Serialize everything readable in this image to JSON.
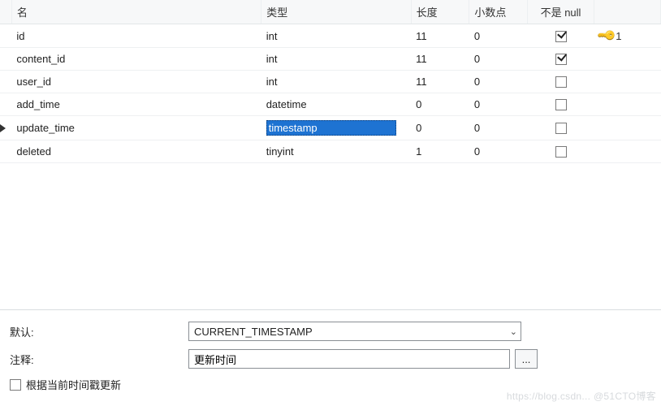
{
  "table": {
    "headers": {
      "name": "名",
      "type": "类型",
      "length": "长度",
      "decimals": "小数点",
      "not_null": "不是 null"
    },
    "rows": [
      {
        "name": "id",
        "type": "int",
        "length": "11",
        "decimals": "0",
        "not_null": true,
        "pk": "1",
        "current": false,
        "selected_type": false
      },
      {
        "name": "content_id",
        "type": "int",
        "length": "11",
        "decimals": "0",
        "not_null": true,
        "pk": "",
        "current": false,
        "selected_type": false
      },
      {
        "name": "user_id",
        "type": "int",
        "length": "11",
        "decimals": "0",
        "not_null": false,
        "pk": "",
        "current": false,
        "selected_type": false
      },
      {
        "name": "add_time",
        "type": "datetime",
        "length": "0",
        "decimals": "0",
        "not_null": false,
        "pk": "",
        "current": false,
        "selected_type": false
      },
      {
        "name": "update_time",
        "type": "timestamp",
        "length": "0",
        "decimals": "0",
        "not_null": false,
        "pk": "",
        "current": true,
        "selected_type": true
      },
      {
        "name": "deleted",
        "type": "tinyint",
        "length": "1",
        "decimals": "0",
        "not_null": false,
        "pk": "",
        "current": false,
        "selected_type": false
      }
    ]
  },
  "props": {
    "default_label": "默认:",
    "default_value": "CURRENT_TIMESTAMP",
    "comment_label": "注释:",
    "comment_value": "更新时间",
    "more_button": "...",
    "on_update_label": "根据当前时间戳更新",
    "on_update_checked": false
  },
  "watermark": "https://blog.csdn... @51CTO博客"
}
